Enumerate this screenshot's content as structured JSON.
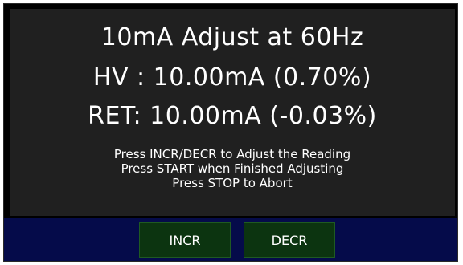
{
  "screen": {
    "title": "10mA Adjust at 60Hz",
    "hv_reading": "HV : 10.00mA (0.70%)",
    "ret_reading": "RET: 10.00mA (-0.03%)",
    "instructions": [
      "Press INCR/DECR to Adjust the Reading",
      "Press START when Finished Adjusting",
      "Press STOP to Abort"
    ]
  },
  "buttons": {
    "incr_label": "INCR",
    "decr_label": "DECR"
  },
  "colors": {
    "display_bg": "#202020",
    "button_bar_bg": "#050b4a",
    "button_bg": "#0c3410",
    "text": "#ffffff"
  }
}
